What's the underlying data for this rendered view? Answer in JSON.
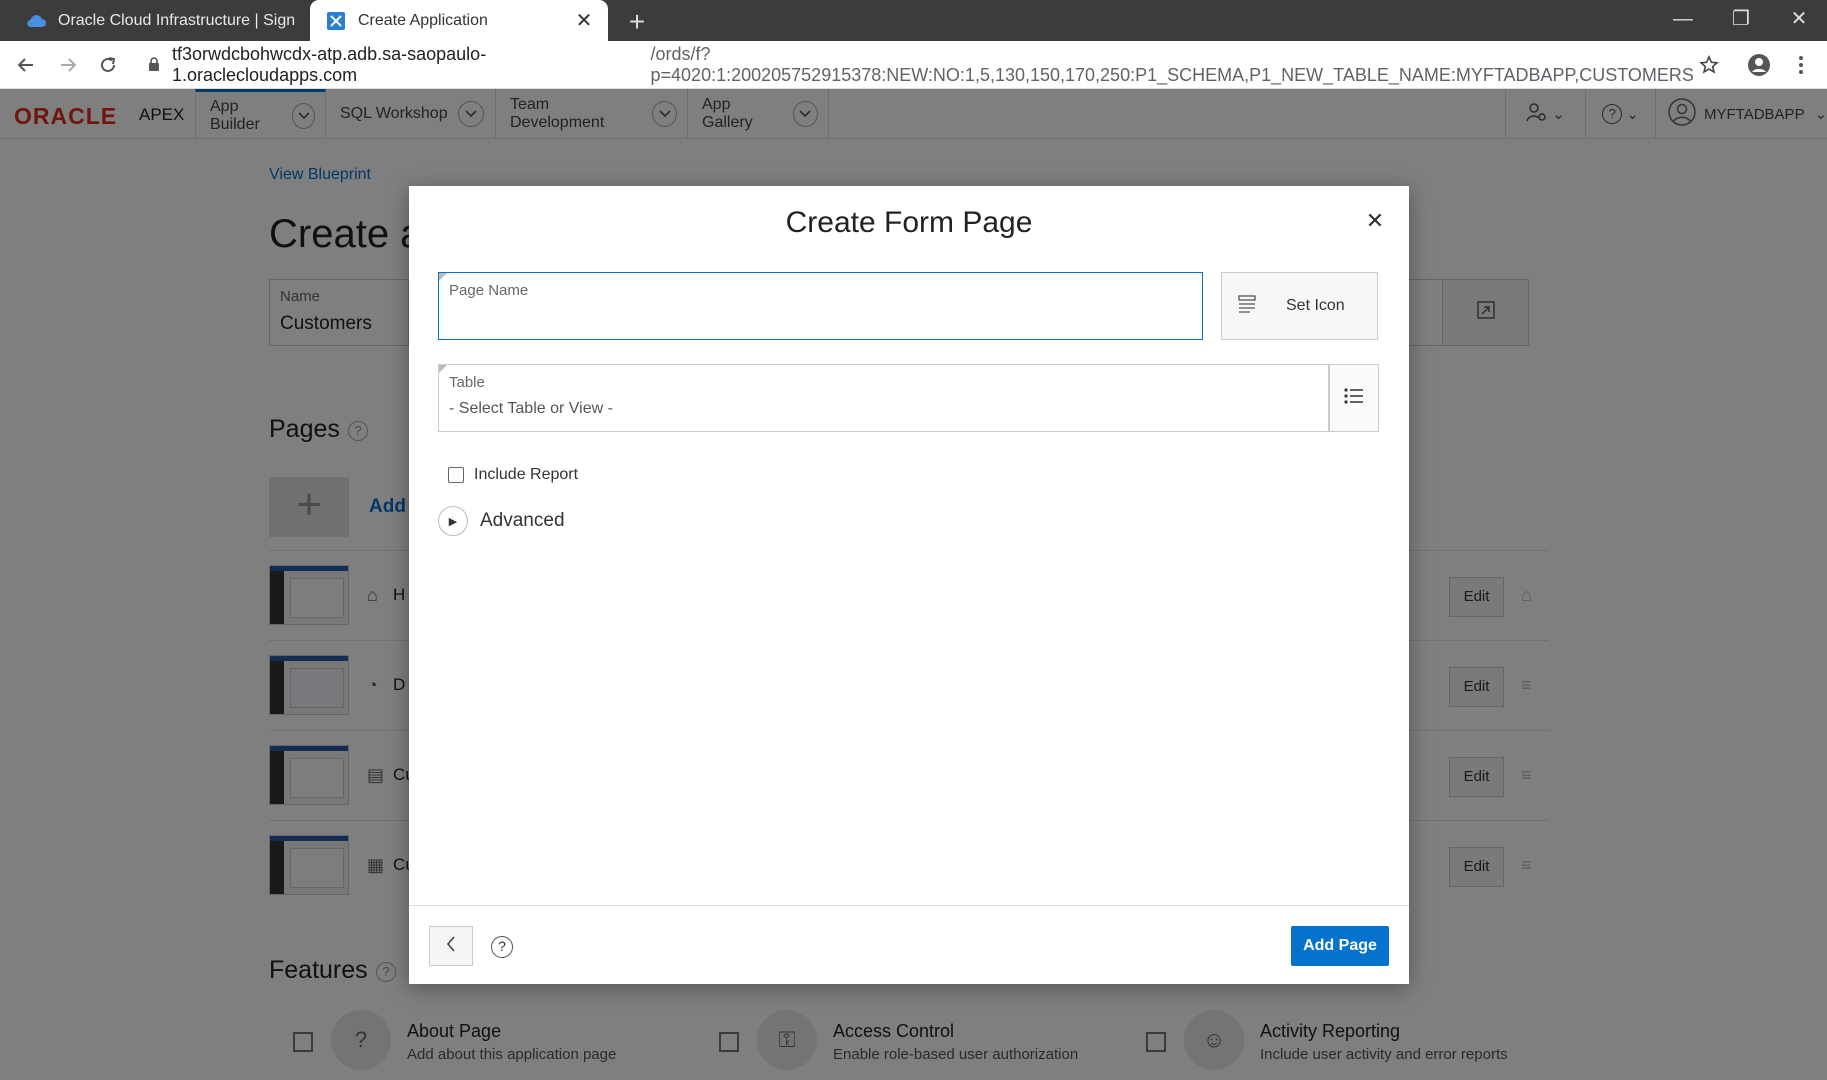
{
  "browser": {
    "tabs": [
      {
        "title": "Oracle Cloud Infrastructure | Sign"
      },
      {
        "title": "Create Application"
      }
    ],
    "url_host": "tf3orwdcbohwcdx-atp.adb.sa-saopaulo-1.oraclecloudapps.com",
    "url_path": "/ords/f?p=4020:1:200205752915378:NEW:NO:1,5,130,150,170,250:P1_SCHEMA,P1_NEW_TABLE_NAME:MYFTADBAPP,CUSTOMERS"
  },
  "apex": {
    "logo_oracle": "ORACLE",
    "logo_apex": "APEX",
    "nav": [
      {
        "label": "App Builder"
      },
      {
        "label": "SQL Workshop"
      },
      {
        "label": "Team Development"
      },
      {
        "label": "App Gallery"
      }
    ],
    "user": "MYFTADBAPP"
  },
  "background": {
    "view_blueprint": "View Blueprint",
    "heading": "Create a",
    "name_label": "Name",
    "name_value": "Customers",
    "pages_heading": "Pages",
    "add_label": "Add",
    "page_rows": [
      {
        "label": "H",
        "edit": "Edit"
      },
      {
        "label": "D",
        "edit": "Edit"
      },
      {
        "label": "Cu",
        "edit": "Edit"
      },
      {
        "label": "Cu",
        "edit": "Edit"
      }
    ],
    "features_heading": "Features",
    "features": [
      {
        "title": "About Page",
        "desc": "Add about this application page"
      },
      {
        "title": "Access Control",
        "desc": "Enable role-based user authorization"
      },
      {
        "title": "Activity Reporting",
        "desc": "Include user activity and error reports"
      }
    ]
  },
  "modal": {
    "title": "Create Form Page",
    "page_name_label": "Page Name",
    "page_name_value": "",
    "set_icon_label": "Set Icon",
    "table_label": "Table",
    "table_placeholder": "- Select Table or View -",
    "include_report_label": "Include Report",
    "include_report_checked": false,
    "advanced_label": "Advanced",
    "add_page_label": "Add Page",
    "help_glyph": "?"
  },
  "colors": {
    "accent": "#0572ce",
    "oracle_red": "#e22d1b"
  }
}
